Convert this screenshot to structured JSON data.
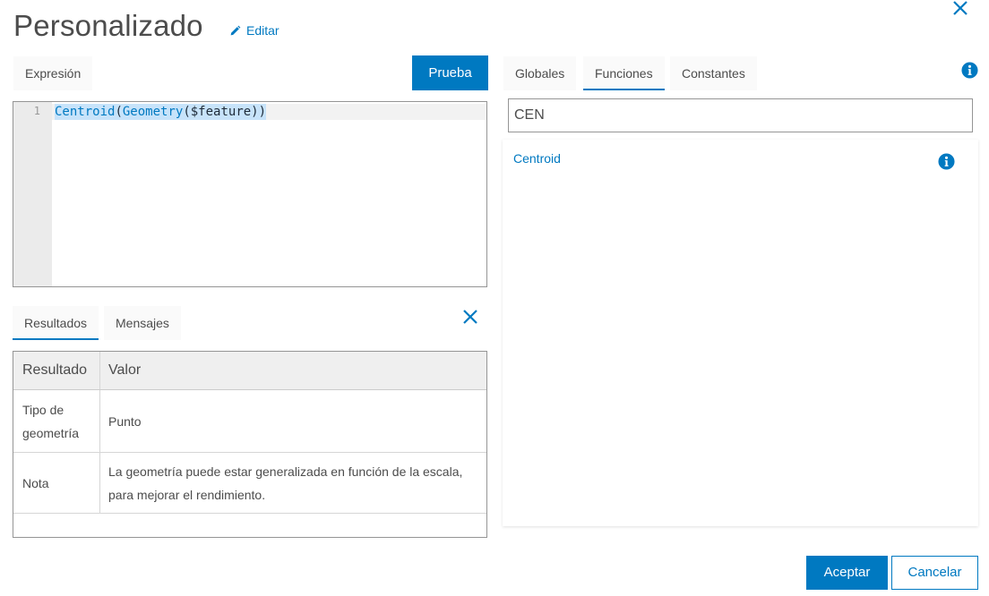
{
  "header": {
    "title": "Personalizado",
    "edit_label": "Editar"
  },
  "editor": {
    "tab_label": "Expresión",
    "test_button": "Prueba",
    "line_number": "1",
    "code": {
      "fn1": "Centroid",
      "p1": "(",
      "fn2": "Geometry",
      "p2": "($feature))"
    }
  },
  "results": {
    "tabs": [
      "Resultados",
      "Mensajes"
    ],
    "active_tab": "Resultados",
    "columns": [
      "Resultado",
      "Valor"
    ],
    "rows": [
      {
        "result": "Tipo de geometría",
        "value": "Punto"
      },
      {
        "result": "Nota",
        "value": "La geometría puede estar generalizada en función de la escala, para mejorar el rendimiento."
      }
    ]
  },
  "sidebar": {
    "tabs": [
      "Globales",
      "Funciones",
      "Constantes"
    ],
    "active_tab": "Funciones",
    "search_value": "CEN",
    "functions": [
      "Centroid"
    ]
  },
  "footer": {
    "accept_button": "Aceptar",
    "cancel_button": "Cancelar"
  },
  "colors": {
    "accent": "#0079c1",
    "selection": "#c7e3fa",
    "gutter": "#ebebeb"
  },
  "icons": [
    "pencil-icon",
    "close-icon",
    "info-icon"
  ]
}
